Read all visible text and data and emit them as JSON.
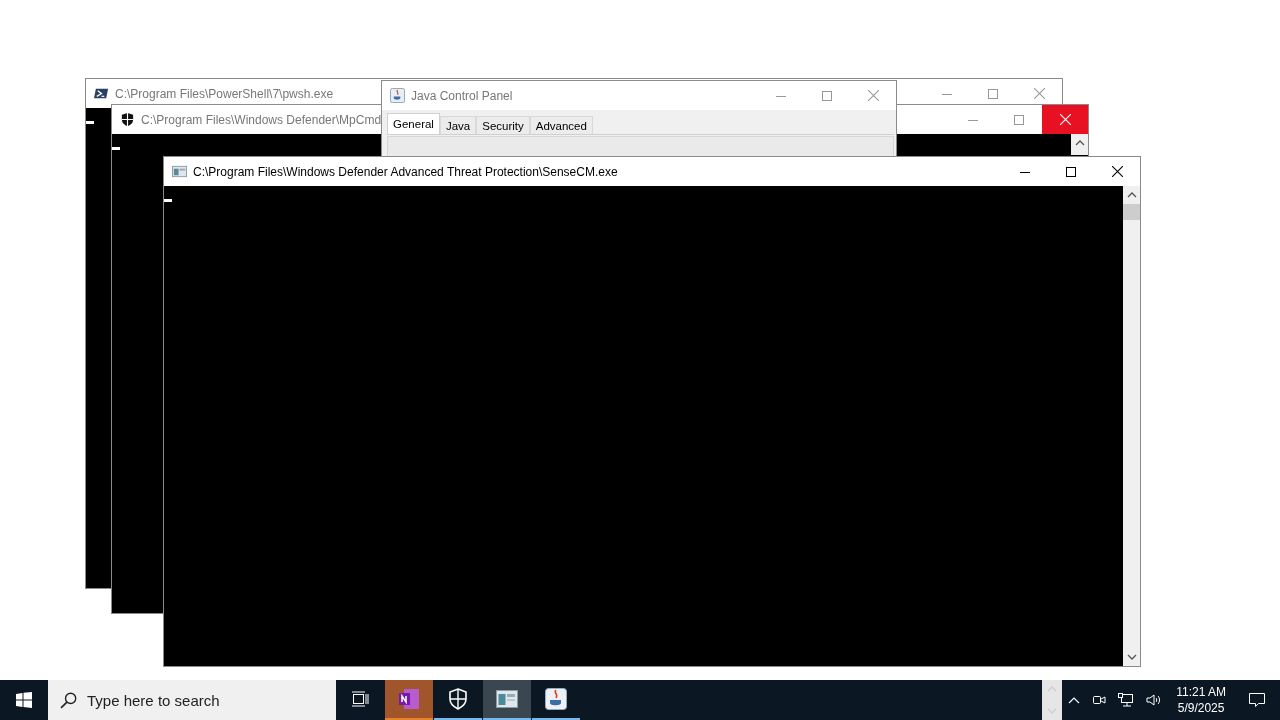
{
  "windows": [
    {
      "kind": "console",
      "title": "C:\\Program Files\\PowerShell\\7\\pwsh.exe",
      "focused": false,
      "close_hover": false
    },
    {
      "kind": "console",
      "title": "C:\\Program Files\\Windows Defender\\MpCmd",
      "focused": false,
      "close_hover": true
    },
    {
      "kind": "java",
      "title": "Java Control Panel",
      "focused": false,
      "close_hover": false,
      "tabs": [
        {
          "label": "General",
          "selected": true
        },
        {
          "label": "Java",
          "selected": false
        },
        {
          "label": "Security",
          "selected": false
        },
        {
          "label": "Advanced",
          "selected": false
        }
      ]
    },
    {
      "kind": "console",
      "title": "C:\\Program Files\\Windows Defender Advanced Threat Protection\\SenseCM.exe",
      "focused": true,
      "close_hover": false
    }
  ],
  "taskbar": {
    "search": {
      "placeholder": "Type here to search"
    },
    "apps": [
      {
        "kind": "onenote",
        "running": true,
        "selected": false,
        "hovered": true
      },
      {
        "kind": "shield",
        "running": true,
        "selected": false,
        "hovered": false
      },
      {
        "kind": "console",
        "running": true,
        "selected": true,
        "hovered": false
      },
      {
        "kind": "java",
        "running": true,
        "selected": false,
        "hovered": false
      }
    ],
    "time": "11:21 AM",
    "date": "5/9/2025"
  }
}
